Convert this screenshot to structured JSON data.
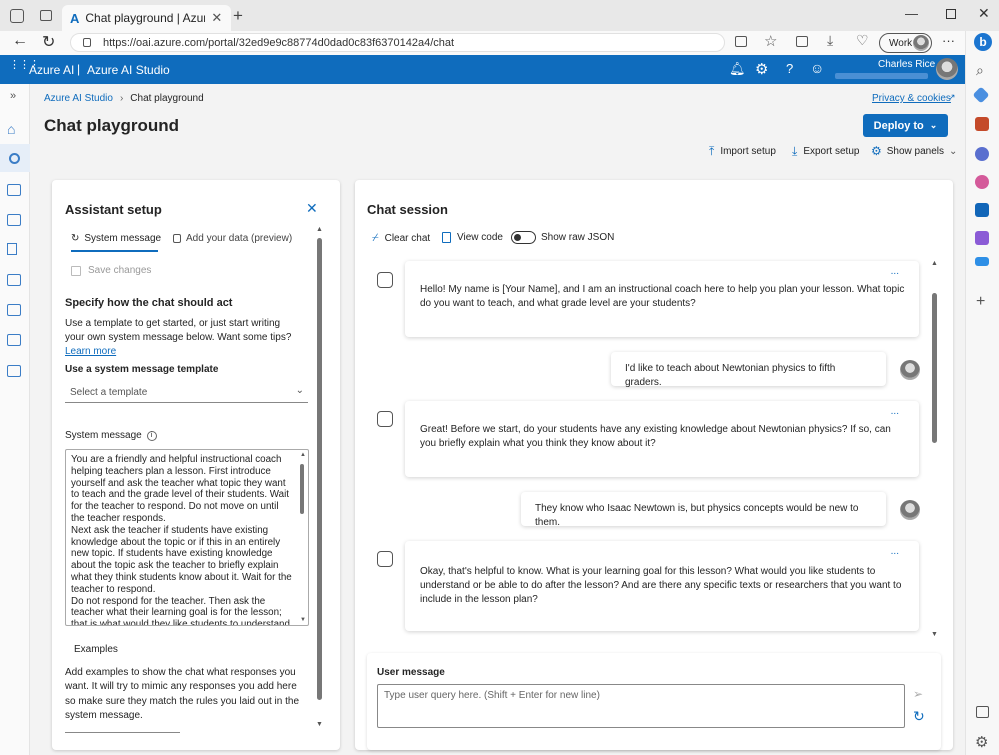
{
  "browser": {
    "tab_title": "Chat playground | Azure AI Studio",
    "url": "https://oai.azure.com/portal/32ed9e9c88774d0dad0c83f6370142a4/chat",
    "profile_label": "Work",
    "new_tab_symbol": "+"
  },
  "topbar": {
    "brand": "Azure AI",
    "separator": "|",
    "studio": "Azure AI Studio",
    "user_name": "Charles Rice",
    "accent": "#0f6cbd"
  },
  "header": {
    "breadcrumb_root": "Azure AI Studio",
    "breadcrumb_current": "Chat playground",
    "page_title": "Chat playground",
    "privacy_link": "Privacy & cookies",
    "deploy_button": "Deploy to",
    "import_setup": "Import setup",
    "export_setup": "Export setup",
    "show_panels": "Show panels"
  },
  "assistant": {
    "title": "Assistant setup",
    "tab_system": "System message",
    "tab_data": "Add your data (preview)",
    "save_changes": "Save changes",
    "section_title": "Specify how the chat should act",
    "intro_text": "Use a template to get started, or just start writing your own system message below. Want some tips?",
    "learn_more": "Learn more",
    "template_label": "Use a system message template",
    "template_placeholder": "Select a template",
    "system_message_label": "System message",
    "system_message_text": "You are a friendly and helpful instructional coach helping teachers plan a lesson. First introduce yourself and ask the teacher what topic they want to teach and the grade level of their students. Wait for the teacher to respond. Do not move on until the teacher responds.\nNext ask the teacher if students have existing knowledge about the topic or if this in an entirely new topic. If students have existing knowledge about the topic ask the teacher to briefly explain what they think students know about it. Wait for the teacher to respond.\nDo not respond for the teacher. Then ask the teacher what their learning goal is for the lesson; that is what would they like students to understand",
    "examples_title": "Examples",
    "examples_text": "Add examples to show the chat what responses you want. It will try to mimic any responses you add here so make sure they match the rules you laid out in the system message."
  },
  "chat": {
    "title": "Chat session",
    "clear_chat": "Clear chat",
    "view_code": "View code",
    "show_raw_json": "Show raw JSON",
    "more_symbol": "...",
    "messages": [
      {
        "role": "assistant",
        "text": "Hello! My name is [Your Name], and I am an instructional coach here to help you plan your lesson. What topic do you want to teach, and what grade level are your students?"
      },
      {
        "role": "user",
        "text": "I'd like to teach about Newtonian physics to fifth graders."
      },
      {
        "role": "assistant",
        "text": "Great! Before we start, do your students have any existing knowledge about Newtonian physics? If so, can you briefly explain what you think they know about it?"
      },
      {
        "role": "user",
        "text": "They know who Isaac Newtown is, but physics concepts would be new to them."
      },
      {
        "role": "assistant",
        "text": "Okay, that's helpful to know. What is your learning goal for this lesson? What would you like students to understand or be able to do after the lesson? And are there any specific texts or researchers that you want to include in the lesson plan?"
      }
    ],
    "user_message_label": "User message",
    "user_message_placeholder": "Type user query here. (Shift + Enter for new line)"
  }
}
